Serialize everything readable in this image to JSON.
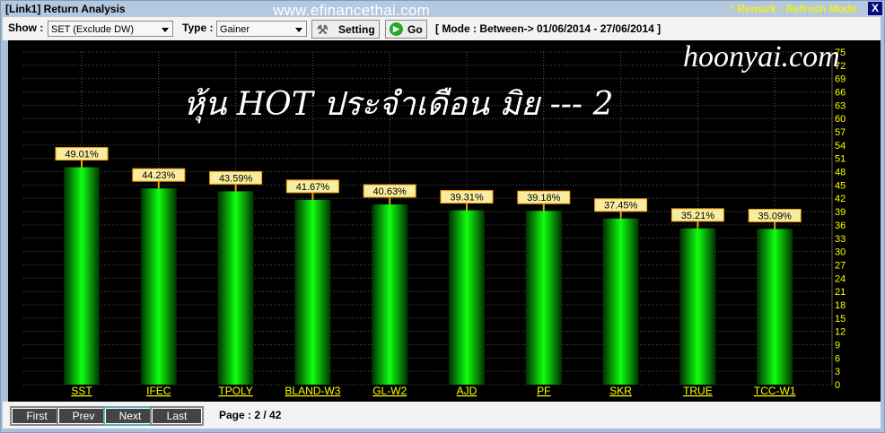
{
  "window": {
    "title": "[Link1] Return Analysis",
    "watermark": "www.efinancethai.com",
    "remark": "* Remark : Refresh Mode",
    "close": "X"
  },
  "toolbar": {
    "show_label": "Show :",
    "show_value": "SET (Exclude DW)",
    "type_label": "Type :",
    "type_value": "Gainer",
    "setting": "Setting",
    "go": "Go",
    "mode": "[ Mode : Between-> 01/06/2014 - 27/06/2014 ]"
  },
  "overlay": {
    "headline": "หุ้น HOT ประจำเดือน มิย --- 2",
    "site": "hoonyai.com"
  },
  "pager": {
    "first": "First",
    "prev": "Prev",
    "next": "Next",
    "last": "Last",
    "page": "Page : 2 / 42"
  },
  "colors": {
    "bar": "#00e000",
    "label_bg": "#f8eca0",
    "label_border": "#f0a000",
    "axis_text": "#ffff00",
    "background": "#000000"
  },
  "chart_data": {
    "type": "bar",
    "categories": [
      "SST",
      "IFEC",
      "TPOLY",
      "BLAND-W3",
      "GL-W2",
      "AJD",
      "PF",
      "SKR",
      "TRUE",
      "TCC-W1"
    ],
    "values": [
      49.01,
      44.23,
      43.59,
      41.67,
      40.63,
      39.31,
      39.18,
      37.45,
      35.21,
      35.09
    ],
    "data_labels": [
      "49.01%",
      "44.23%",
      "43.59%",
      "41.67%",
      "40.63%",
      "39.31%",
      "39.18%",
      "37.45%",
      "35.21%",
      "35.09%"
    ],
    "ylim": [
      0,
      75
    ],
    "yticks": [
      0,
      3,
      6,
      9,
      12,
      15,
      18,
      21,
      24,
      27,
      30,
      33,
      36,
      39,
      42,
      45,
      48,
      51,
      54,
      57,
      60,
      63,
      66,
      69,
      72,
      75
    ],
    "y_axis_side": "right",
    "grid": true
  }
}
